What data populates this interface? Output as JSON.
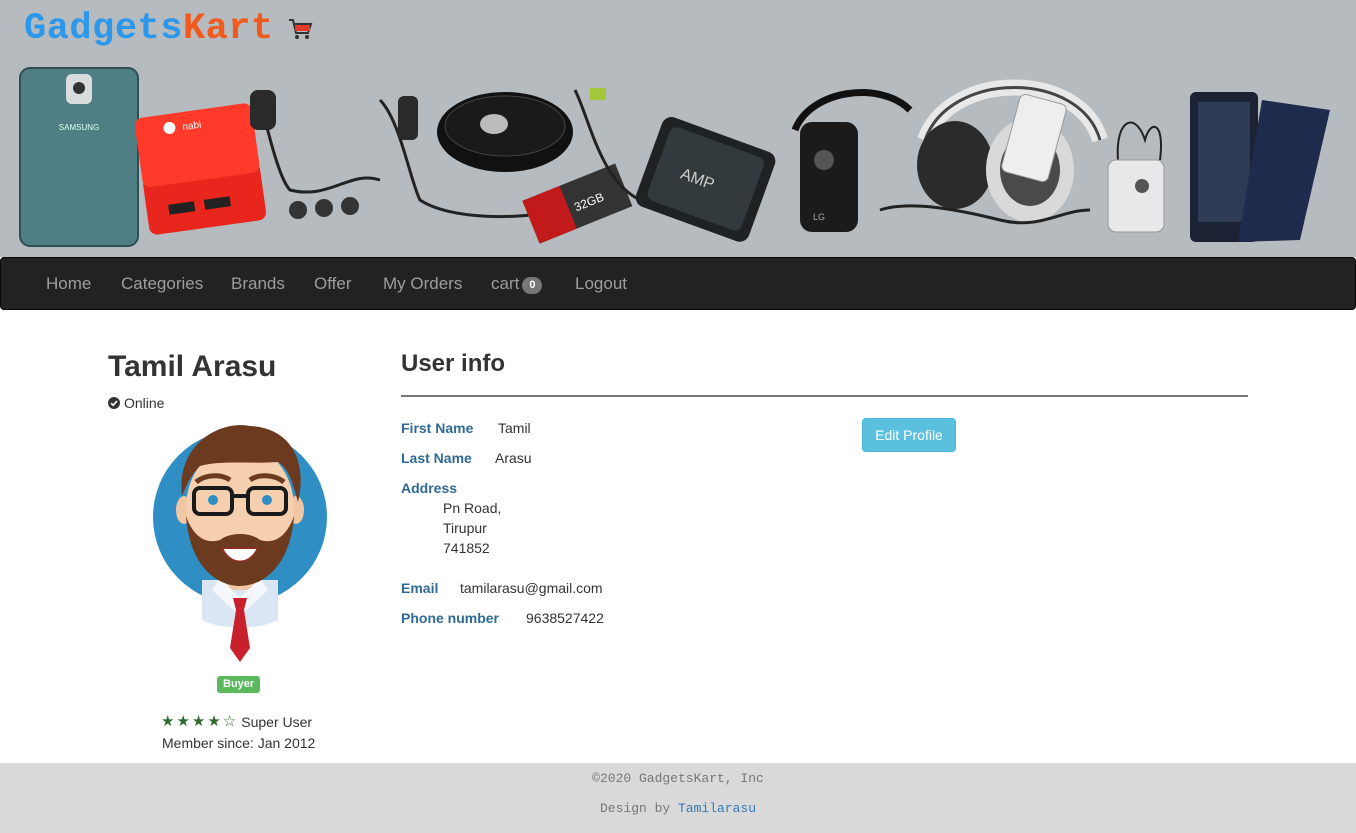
{
  "brand": {
    "part1": "Gadgets",
    "part2": "Kart"
  },
  "nav": {
    "items": [
      "Home",
      "Categories",
      "Brands",
      "Offer",
      "My Orders"
    ],
    "cart_label": "cart",
    "cart_count": "0",
    "logout": "Logout"
  },
  "profile": {
    "name": "Tamil Arasu",
    "status": "Online",
    "role": "Buyer",
    "rating": 4,
    "rating_max": 5,
    "rating_label": "Super User",
    "member_since": "Member since: Jan 2012"
  },
  "user_info": {
    "title": "User info",
    "first_name_label": "First Name",
    "first_name": "Tamil",
    "last_name_label": "Last Name",
    "last_name": "Arasu",
    "address_label": "Address",
    "address_line1": "Pn Road,",
    "address_line2": "Tirupur",
    "address_line3": "741852",
    "email_label": "Email",
    "email": "tamilarasu@gmail.com",
    "phone_label": "Phone number",
    "phone": "9638527422",
    "edit_button": "Edit Profile"
  },
  "footer": {
    "copyright": "©2020 GadgetsKart, Inc",
    "design_prefix": "Design by ",
    "designer": "Tamilarasu"
  },
  "colors": {
    "logo_blue": "#2b98ec",
    "logo_orange": "#f05a1c",
    "navbar": "#222222",
    "label_blue": "#2f6a94",
    "button_info": "#5bc0de",
    "badge_success": "#5cb85c",
    "avatar_bg": "#2f8fc4"
  }
}
